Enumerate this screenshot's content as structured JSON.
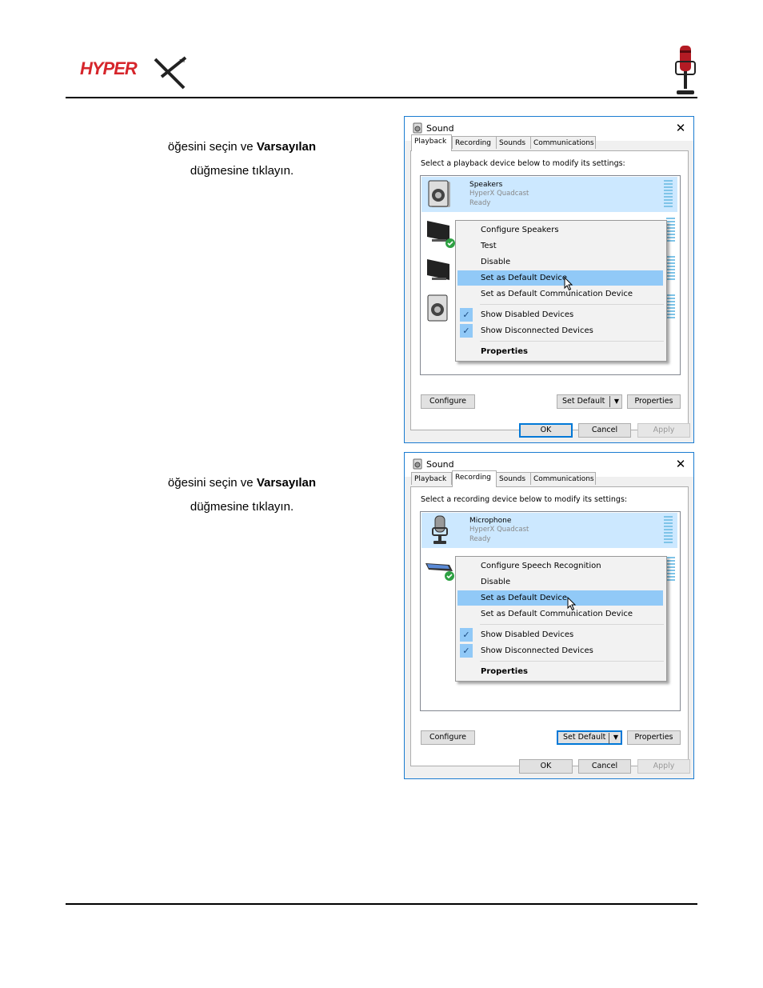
{
  "header": {
    "brand": "HYPERX"
  },
  "steps": [
    {
      "text_before": "öğesini seçin ve ",
      "text_bold": "Varsayılan",
      "text_line2": "düğmesine tıklayın."
    },
    {
      "text_before": "öğesini seçin ve ",
      "text_bold": "Varsayılan",
      "text_line2": "düğmesine tıklayın."
    }
  ],
  "dialogs": [
    {
      "title": "Sound",
      "close_glyph": "✕",
      "tabs": [
        "Playback",
        "Recording",
        "Sounds",
        "Communications"
      ],
      "active_tab": "Playback",
      "instruction": "Select a playback device below to modify its settings:",
      "selected_device": {
        "name": "Speakers",
        "subtitle": "HyperX Quadcast",
        "status": "Ready"
      },
      "menu": {
        "items": [
          "Configure Speakers",
          "Test",
          "Disable",
          "Set as Default Device",
          "Set as Default Communication Device"
        ],
        "checked_items": [
          "Show Disabled Devices",
          "Show Disconnected Devices"
        ],
        "properties": "Properties",
        "highlighted": "Set as Default Device"
      },
      "buttons": {
        "configure": "Configure",
        "set_default": "Set Default",
        "properties": "Properties",
        "ok": "OK",
        "cancel": "Cancel",
        "apply": "Apply"
      }
    },
    {
      "title": "Sound",
      "close_glyph": "✕",
      "tabs": [
        "Playback",
        "Recording",
        "Sounds",
        "Communications"
      ],
      "active_tab": "Recording",
      "instruction": "Select a recording device below to modify its settings:",
      "selected_device": {
        "name": "Microphone",
        "subtitle": "HyperX Quadcast",
        "status": "Ready"
      },
      "menu": {
        "items": [
          "Configure Speech Recognition",
          "Disable",
          "Set as Default Device",
          "Set as Default Communication Device"
        ],
        "checked_items": [
          "Show Disabled Devices",
          "Show Disconnected Devices"
        ],
        "properties": "Properties",
        "highlighted": "Set as Default Device"
      },
      "buttons": {
        "configure": "Configure",
        "set_default": "Set Default",
        "properties": "Properties",
        "ok": "OK",
        "cancel": "Cancel",
        "apply": "Apply"
      }
    }
  ],
  "colors": {
    "selection": "#cce8ff",
    "menu_highlight": "#91c9f7",
    "dialog_border": "#1b7cd1",
    "logo_red": "#d6252b"
  }
}
